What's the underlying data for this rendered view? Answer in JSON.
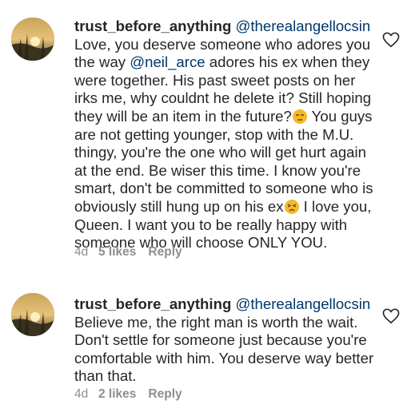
{
  "comments": [
    {
      "username": "trust_before_anything",
      "mention_prefix": "@therealangellocsin",
      "text_part1": "Love, you deserve someone who adores you the way ",
      "inline_mention": "@neil_arce",
      "text_part2": " adores his ex when they were together. His past sweet posts on her irks me, why couldnt he delete it? Still hoping they will be an item in the future?",
      "emoji1": "unamused-face-emoji",
      "text_part3": " You guys are not getting younger, stop with the M.U. thingy, you're the one who will get hurt again at the end. Be wiser this time. I know you're smart, don't be committed to someone who is obviously still hung up on his ex",
      "emoji2": "persevering-face-emoji",
      "text_part4": " I love you, Queen. I want you to be really happy with someone who will choose ONLY YOU.",
      "time": "4d",
      "likes": "5 likes",
      "reply": "Reply"
    },
    {
      "username": "trust_before_anything",
      "mention_prefix": "@therealangellocsin",
      "text": "Believe me, the right man is worth the wait. Don't settle for someone just because you're comfortable with him. You deserve way better than that.",
      "time": "4d",
      "likes": "2 likes",
      "reply": "Reply"
    }
  ],
  "colors": {
    "text": "#262626",
    "mention": "#00376b",
    "meta": "#8e8e8e",
    "emoji": "#f5b82a"
  }
}
